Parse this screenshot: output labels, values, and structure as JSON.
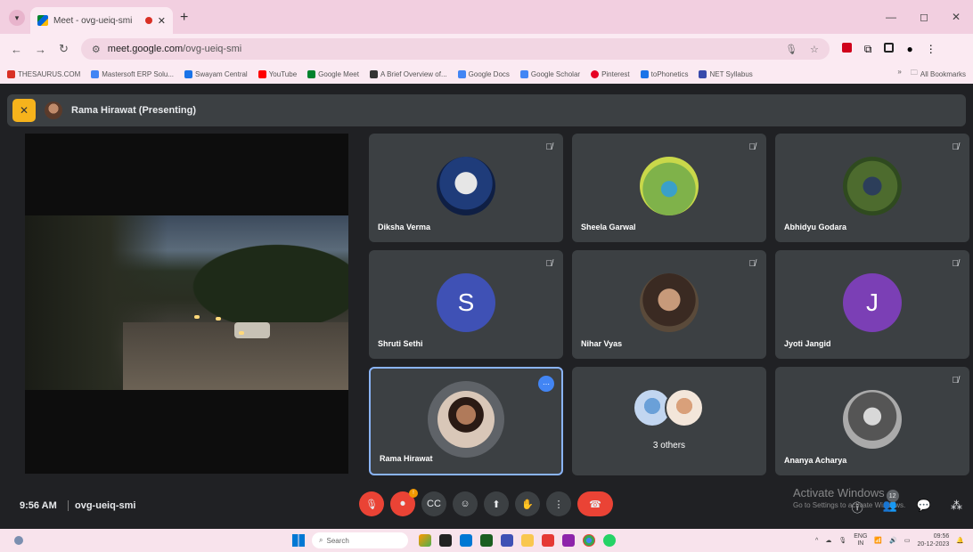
{
  "browser": {
    "tab_title": "Meet - ovg-ueiq-smi",
    "url_host": "meet.google.com",
    "url_path": "/ovg-ueiq-smi",
    "bookmarks": [
      {
        "label": "THESAURUS.COM",
        "color": "#d93025"
      },
      {
        "label": "Mastersoft ERP Solu...",
        "color": "#4285f4"
      },
      {
        "label": "Swayam Central",
        "color": "#1a73e8"
      },
      {
        "label": "YouTube",
        "color": "#ff0000"
      },
      {
        "label": "Google Meet",
        "color": "#00832d"
      },
      {
        "label": "A Brief Overview of...",
        "color": "#333333"
      },
      {
        "label": "Google Docs",
        "color": "#4285f4"
      },
      {
        "label": "Google Scholar",
        "color": "#4285f4"
      },
      {
        "label": "Pinterest",
        "color": "#e60023"
      },
      {
        "label": "toPhonetics",
        "color": "#1a73e8"
      },
      {
        "label": "NET Syllabus",
        "color": "#3949ab"
      }
    ],
    "bookmarks_more": "»",
    "all_bookmarks": "All Bookmarks"
  },
  "meet": {
    "presenting_label": "Rama Hirawat (Presenting)",
    "time": "9:56 AM",
    "meeting_code": "ovg-ueiq-smi",
    "participants_count": "12",
    "watermark_title": "Activate Windows",
    "watermark_sub": "Go to Settings to activate Windows.",
    "tiles": [
      {
        "name": "Diksha Verma",
        "kind": "photo",
        "bg": "radial-gradient(circle at 50% 45%, #e6e6e6 0 25%, #1f3c7a 26% 60%, #0f1f44 61%)"
      },
      {
        "name": "Sheela Garwal",
        "kind": "photo",
        "bg": "radial-gradient(circle at 50% 55%, #3aa0c9 0 18%, #7fb24a 19% 60%, #c9d84a 61%)"
      },
      {
        "name": "Abhidyu Godara",
        "kind": "photo",
        "bg": "radial-gradient(circle at 50% 50%, #2c3e5a 0 22%, #4d6b2e 23% 60%, #2f4a1f 61%)"
      },
      {
        "name": "Shruti Sethi",
        "kind": "letter",
        "letter": "S",
        "color": "#3f51b5"
      },
      {
        "name": "Nihar Vyas",
        "kind": "photo",
        "bg": "radial-gradient(circle at 50% 45%, #c79a7a 0 25%, #3a2a22 26% 60%, #5a4a3a 61%)"
      },
      {
        "name": "Jyoti Jangid",
        "kind": "letter",
        "letter": "J",
        "color": "#7b3fb5"
      },
      {
        "name": "Rama Hirawat",
        "kind": "speaker",
        "bg": "radial-gradient(circle at 50% 42%, #b07a5a 0 22%, #2a1a14 23% 40%, #d9c7b8 41%)"
      },
      {
        "name": "3 others",
        "kind": "others"
      },
      {
        "name": "Ananya Acharya",
        "kind": "photo",
        "bg": "radial-gradient(circle at 50% 45%, #d8d8d8 0 20%, #555 21% 55%, #aaa 56%)"
      }
    ]
  },
  "taskbar": {
    "search_placeholder": "Search",
    "lang_top": "ENG",
    "lang_bottom": "IN",
    "clock_time": "09:56",
    "clock_date": "20-12-2023"
  }
}
